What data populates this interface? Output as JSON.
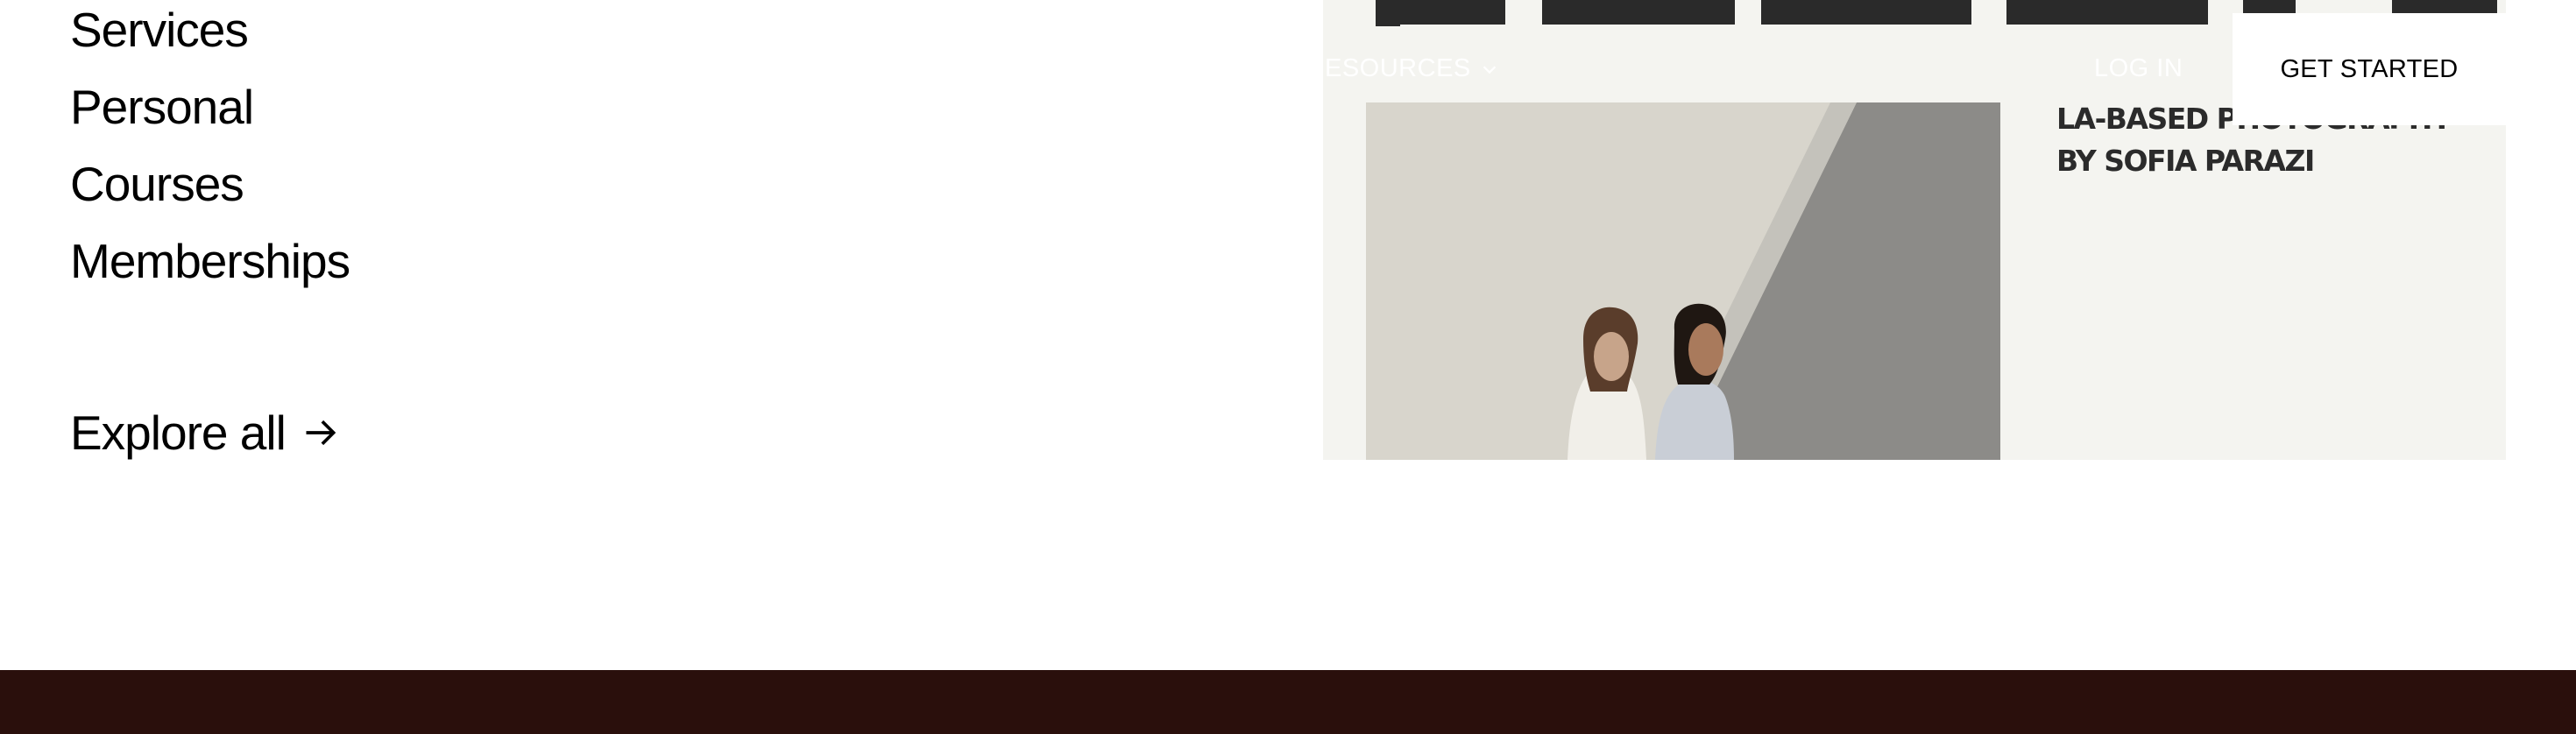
{
  "menu": {
    "items": [
      "Services",
      "Personal",
      "Courses",
      "Memberships"
    ],
    "explore_label": "Explore all"
  },
  "preview": {
    "nav": {
      "resources_label": "ESOURCES",
      "login_label": "LOG IN",
      "cta_label": "GET STARTED"
    },
    "caption": [
      "LA-BASED PHOTOGRAPHY",
      "BY SOFIA PARAZI"
    ],
    "colors": {
      "panel_bg": "#f4f4f0",
      "title_text": "#2a2a2a",
      "footer_bg": "#2a0f0c"
    }
  },
  "icons": {
    "explore": "arrow-right-icon",
    "resources": "chevron-down-icon"
  }
}
